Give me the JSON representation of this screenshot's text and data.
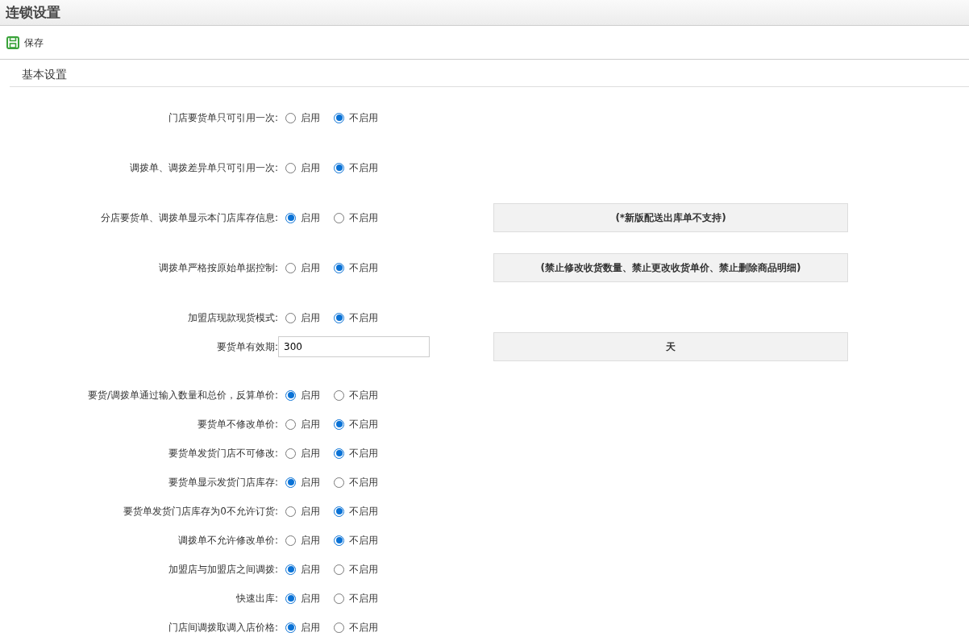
{
  "window": {
    "title": "连锁设置"
  },
  "toolbar": {
    "save_label": "保存"
  },
  "section": {
    "title": "基本设置"
  },
  "groups": [
    {
      "rows": [
        {
          "kind": "radio",
          "label": "门店要货单只可引用一次:",
          "options": [
            {
              "label": "启用",
              "selected": false
            },
            {
              "label": "不启用",
              "selected": true
            }
          ]
        },
        {
          "kind": "radio",
          "label": "调拨单、调拨差异单只可引用一次:",
          "options": [
            {
              "label": "启用",
              "selected": false
            },
            {
              "label": "不启用",
              "selected": true
            }
          ]
        },
        {
          "kind": "radio",
          "label": "分店要货单、调拨单显示本门店库存信息:",
          "options": [
            {
              "label": "启用",
              "selected": true
            },
            {
              "label": "不启用",
              "selected": false
            }
          ],
          "note": "(*新版配送出库单不支持)"
        },
        {
          "kind": "radio",
          "label": "调拨单严格按原始单据控制:",
          "options": [
            {
              "label": "启用",
              "selected": false
            },
            {
              "label": "不启用",
              "selected": true
            }
          ],
          "note": "(禁止修改收货数量、禁止更改收货单价、禁止删除商品明细)"
        },
        {
          "kind": "radio",
          "label": "加盟店现款现货模式:",
          "options": [
            {
              "label": "启用",
              "selected": false
            },
            {
              "label": "不启用",
              "selected": true
            }
          ]
        }
      ]
    },
    {
      "rows": [
        {
          "kind": "input",
          "label": "要货单有效期:",
          "value": "300",
          "note": "天"
        }
      ]
    },
    {
      "rows": [
        {
          "kind": "radio",
          "label": "要货/调拨单通过输入数量和总价，反算单价:",
          "options": [
            {
              "label": "启用",
              "selected": true
            },
            {
              "label": "不启用",
              "selected": false
            }
          ]
        },
        {
          "kind": "radio",
          "label": "要货单不修改单价:",
          "options": [
            {
              "label": "启用",
              "selected": false
            },
            {
              "label": "不启用",
              "selected": true
            }
          ]
        },
        {
          "kind": "radio",
          "label": "要货单发货门店不可修改:",
          "options": [
            {
              "label": "启用",
              "selected": false
            },
            {
              "label": "不启用",
              "selected": true
            }
          ]
        },
        {
          "kind": "radio",
          "label": "要货单显示发货门店库存:",
          "options": [
            {
              "label": "启用",
              "selected": true
            },
            {
              "label": "不启用",
              "selected": false
            }
          ]
        },
        {
          "kind": "radio",
          "label": "要货单发货门店库存为0不允许订货:",
          "options": [
            {
              "label": "启用",
              "selected": false
            },
            {
              "label": "不启用",
              "selected": true
            }
          ]
        },
        {
          "kind": "radio",
          "label": "调拨单不允许修改单价:",
          "options": [
            {
              "label": "启用",
              "selected": false
            },
            {
              "label": "不启用",
              "selected": true
            }
          ]
        },
        {
          "kind": "radio",
          "label": "加盟店与加盟店之间调拨:",
          "options": [
            {
              "label": "启用",
              "selected": true
            },
            {
              "label": "不启用",
              "selected": false
            }
          ]
        },
        {
          "kind": "radio",
          "label": "快速出库:",
          "options": [
            {
              "label": "启用",
              "selected": true
            },
            {
              "label": "不启用",
              "selected": false
            }
          ]
        },
        {
          "kind": "radio",
          "label": "门店间调拨取调入店价格:",
          "options": [
            {
              "label": "启用",
              "selected": true
            },
            {
              "label": "不启用",
              "selected": false
            }
          ]
        }
      ]
    }
  ]
}
